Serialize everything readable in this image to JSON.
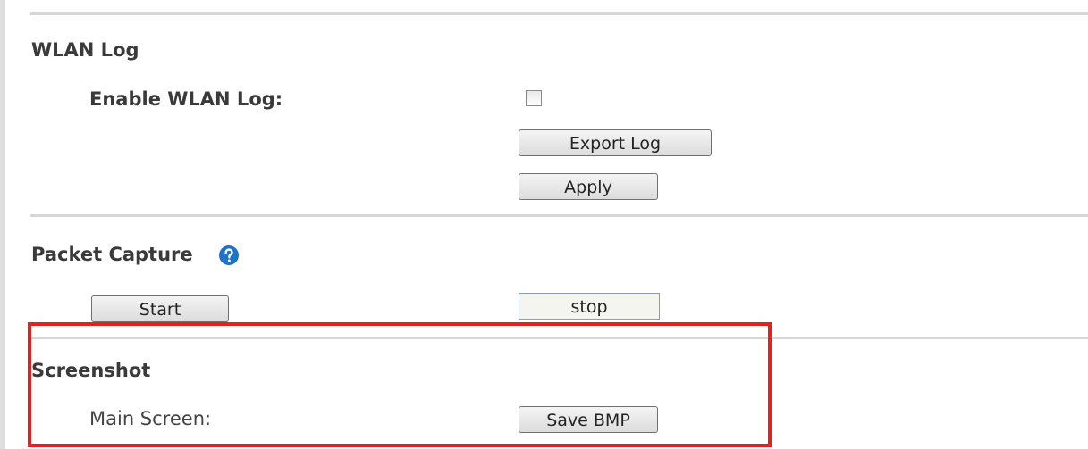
{
  "wlan_log": {
    "title": "WLAN Log",
    "enable_label": "Enable WLAN Log:",
    "enable_checked": false,
    "export_button": "Export Log",
    "apply_button": "Apply"
  },
  "packet_capture": {
    "title": "Packet Capture",
    "help_icon": "question-circle-icon",
    "start_button": "Start",
    "stop_button": "stop"
  },
  "screenshot": {
    "title": "Screenshot",
    "main_screen_label": "Main Screen:",
    "save_button": "Save BMP"
  },
  "colors": {
    "highlight": "#ee1d1d",
    "help_icon": "#1e72c8"
  }
}
